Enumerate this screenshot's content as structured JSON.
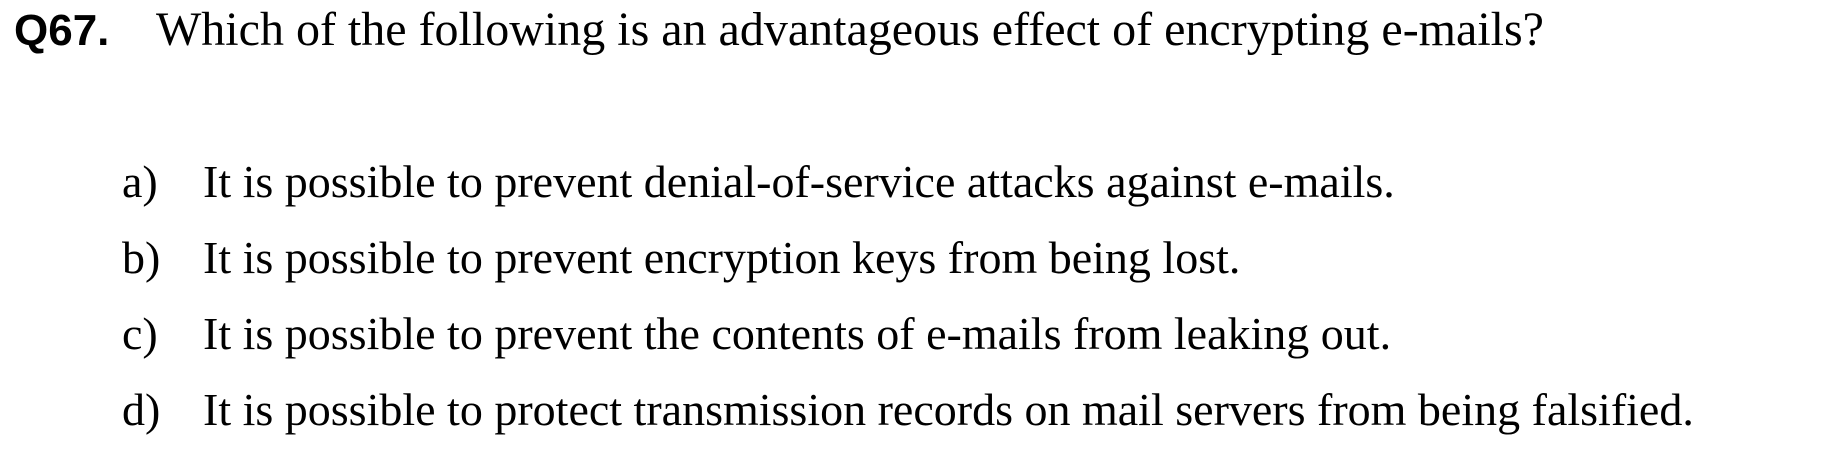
{
  "question": {
    "number": "Q67.",
    "text": "Which of the following is an advantageous effect of encrypting e-mails?"
  },
  "options": [
    {
      "letter": "a)",
      "text": "It is possible to prevent denial-of-service attacks against e-mails."
    },
    {
      "letter": "b)",
      "text": "It is possible to prevent encryption keys from being lost."
    },
    {
      "letter": "c)",
      "text": "It is possible to prevent the contents of e-mails from leaking out."
    },
    {
      "letter": "d)",
      "text": "It is possible to protect transmission records on mail servers from being falsified."
    }
  ]
}
